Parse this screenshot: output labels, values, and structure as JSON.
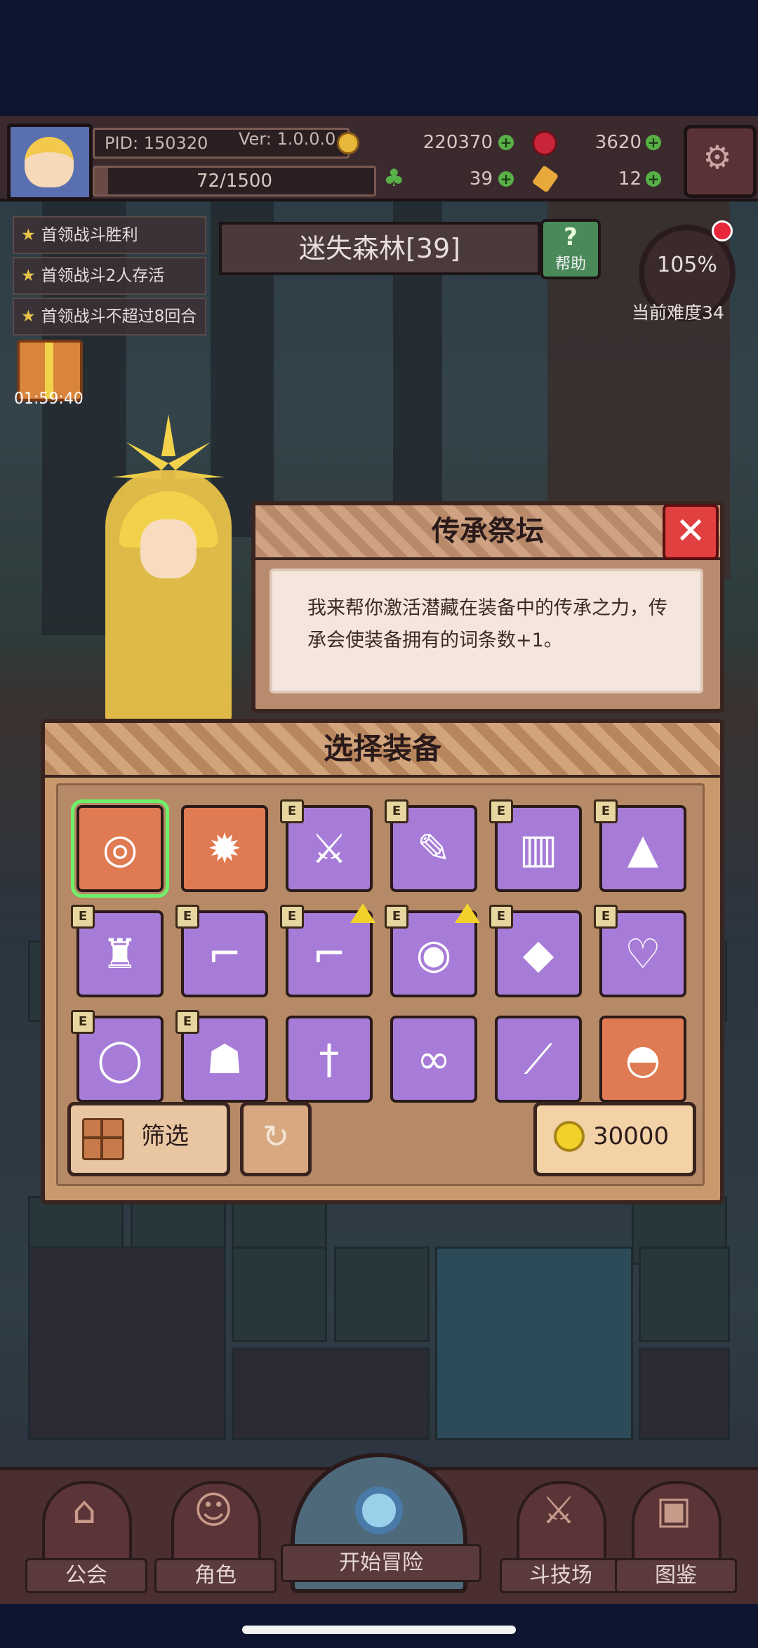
{
  "header": {
    "pid": "PID: 150320",
    "version": "Ver: 1.0.0.0",
    "gold": "220370",
    "gems": "3620",
    "exp": "72/1500",
    "exp_progress": 0.048,
    "clovers": "39",
    "keys": "12"
  },
  "quests": [
    {
      "label": "首领战斗胜利"
    },
    {
      "label": "首领战斗2人存活"
    },
    {
      "label": "首领战斗不超过8回合"
    }
  ],
  "stage": {
    "title": "迷失森林[39]",
    "help_label": "帮助",
    "help_icon_char": "?",
    "difficulty_pct": "105%",
    "difficulty_label": "当前难度34",
    "gift_timer": "01:59:40"
  },
  "altar": {
    "title": "传承祭坛",
    "description": "我来帮你激活潜藏在装备中的传承之力，传承会使装备拥有的词条数+1。",
    "close_icon_char": "✕"
  },
  "equipment": {
    "title": "选择装备",
    "badge_letter": "E",
    "items": [
      {
        "icon": "dark-belt-icon",
        "glyph": "◎",
        "rarity": "orange",
        "selected": true,
        "badge": false,
        "upgrade": false
      },
      {
        "icon": "crystal-gem-icon",
        "glyph": "✹",
        "rarity": "orange",
        "selected": false,
        "badge": false,
        "upgrade": false
      },
      {
        "icon": "greatsword-icon",
        "glyph": "⚔",
        "rarity": "purple",
        "selected": false,
        "badge": true,
        "upgrade": false
      },
      {
        "icon": "magic-wand-icon",
        "glyph": "✎",
        "rarity": "purple",
        "selected": false,
        "badge": true,
        "upgrade": false
      },
      {
        "icon": "quiver-icon",
        "glyph": "▥",
        "rarity": "purple",
        "selected": false,
        "badge": true,
        "upgrade": false
      },
      {
        "icon": "witch-hat-icon",
        "glyph": "▲",
        "rarity": "purple",
        "selected": false,
        "badge": true,
        "upgrade": false
      },
      {
        "icon": "robe-icon",
        "glyph": "♜",
        "rarity": "purple",
        "selected": false,
        "badge": true,
        "upgrade": false
      },
      {
        "icon": "boots-icon",
        "glyph": "⌐",
        "rarity": "purple",
        "selected": false,
        "badge": true,
        "upgrade": false
      },
      {
        "icon": "armored-boots-icon",
        "glyph": "⌐",
        "rarity": "purple",
        "selected": false,
        "badge": true,
        "upgrade": true
      },
      {
        "icon": "golden-amulet-icon",
        "glyph": "◉",
        "rarity": "purple",
        "selected": false,
        "badge": true,
        "upgrade": true
      },
      {
        "icon": "golden-emblem-icon",
        "glyph": "◆",
        "rarity": "purple",
        "selected": false,
        "badge": true,
        "upgrade": false
      },
      {
        "icon": "jade-necklace-icon",
        "glyph": "♡",
        "rarity": "purple",
        "selected": false,
        "badge": true,
        "upgrade": false
      },
      {
        "icon": "emerald-ring-icon",
        "glyph": "◯",
        "rarity": "purple",
        "selected": false,
        "badge": true,
        "upgrade": false
      },
      {
        "icon": "dark-armor-icon",
        "glyph": "☗",
        "rarity": "purple",
        "selected": false,
        "badge": true,
        "upgrade": false
      },
      {
        "icon": "short-sword-icon",
        "glyph": "†",
        "rarity": "purple",
        "selected": false,
        "badge": false,
        "upgrade": false
      },
      {
        "icon": "whip-icon",
        "glyph": "∞",
        "rarity": "purple",
        "selected": false,
        "badge": false,
        "upgrade": false
      },
      {
        "icon": "dagger-icon",
        "glyph": "⟋",
        "rarity": "purple",
        "selected": false,
        "badge": false,
        "upgrade": false
      },
      {
        "icon": "golden-helmet-icon",
        "glyph": "◓",
        "rarity": "orange",
        "selected": false,
        "badge": false,
        "upgrade": false
      }
    ],
    "filter_label": "筛选",
    "refresh_icon_char": "↻",
    "cost": "30000"
  },
  "nav": {
    "guild": "公会",
    "character": "角色",
    "adventure": "开始冒险",
    "arena": "斗技场",
    "codex": "图鉴",
    "guild_icon_char": "⌂",
    "character_icon_char": "☺",
    "arena_icon_char": "⚔",
    "codex_icon_char": "▣"
  },
  "colors": {
    "purple_slot": "#a77cd8",
    "orange_slot": "#e07a52",
    "selected_outline": "#6ef06a",
    "close_red": "#e04040"
  }
}
